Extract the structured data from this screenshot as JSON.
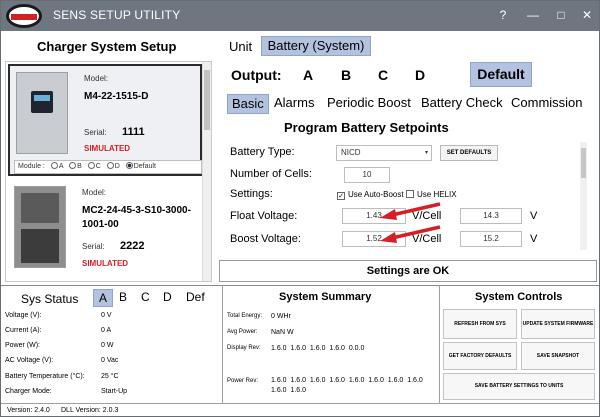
{
  "app": {
    "title": "SENS SETUP UTILITY"
  },
  "window_controls": {
    "help": "?",
    "minimize": "—",
    "maximize": "□",
    "close": "✕"
  },
  "left": {
    "title": "Charger System Setup",
    "chargers": [
      {
        "model_label": "Model:",
        "model": "M4-22-1515-D",
        "serial_label": "Serial:",
        "serial": "1111",
        "status": "SIMULATED",
        "selected": true
      },
      {
        "model_label": "Model:",
        "model": "MC2-24-45-3-S10-3000-1001-00",
        "serial_label": "Serial:",
        "serial": "2222",
        "status": "SIMULATED",
        "selected": false
      }
    ],
    "module_row": {
      "label": "Module",
      "separator": ":",
      "options": [
        "A",
        "B",
        "C",
        "D",
        "Default"
      ],
      "selected": "Default"
    }
  },
  "unit": {
    "label": "Unit",
    "value": "Battery (System)"
  },
  "output": {
    "label": "Output:",
    "options": [
      "A",
      "B",
      "C",
      "D"
    ],
    "default_label": "Default"
  },
  "tabs": [
    "Basic",
    "Alarms",
    "Periodic Boost",
    "Battery Check",
    "Commission"
  ],
  "program": {
    "title": "Program Battery Setpoints",
    "battery_type_label": "Battery Type:",
    "battery_type": "NICD",
    "set_defaults": "SET DEFAULTS",
    "cells_label": "Number of Cells:",
    "cells": "10",
    "settings_label": "Settings:",
    "auto_boost_label": "Use Auto-Boost",
    "auto_boost_checked": true,
    "helix_label": "Use HELIX",
    "helix_checked": false,
    "float_label": "Float Voltage:",
    "float_value": "1.43",
    "float_unit": "V/Cell",
    "float_total": "14.3",
    "float_total_unit": "V",
    "boost_label": "Boost Voltage:",
    "boost_value": "1.52",
    "boost_unit": "V/Cell",
    "boost_total": "15.2",
    "boost_total_unit": "V"
  },
  "status_message": "Settings are OK",
  "sys_status": {
    "title": "Sys Status",
    "options": [
      "A",
      "B",
      "C",
      "D",
      "Def"
    ],
    "selected": "A",
    "rows": [
      {
        "label": "Voltage (V):",
        "value": "0 V"
      },
      {
        "label": "Current (A):",
        "value": "0 A"
      },
      {
        "label": "Power (W):",
        "value": "0 W"
      },
      {
        "label": "AC Voltage (V):",
        "value": "0 Vac"
      },
      {
        "label": "Battery Temperature (°C):",
        "value": "25 °C"
      },
      {
        "label": "Charger Mode:",
        "value": "Start-Up"
      }
    ]
  },
  "summary": {
    "title": "System Summary",
    "total_energy_label": "Total Energy:",
    "total_energy": "0 WHr",
    "avg_power_label": "Avg Power:",
    "avg_power": "NaN W",
    "display_rev_label": "Display Rev:",
    "display_rev": "1.6.0  1.6.0  1.6.0  1.6.0  0.0.0",
    "power_rev_label": "Power Rev:",
    "power_rev": "1.6.0  1.6.0  1.6.0  1.6.0  1.6.0  1.6.0  1.6.0  1.6.0  1.6.0  1.6.0"
  },
  "controls": {
    "title": "System Controls",
    "refresh": "REFRESH FROM SYS",
    "update_firmware": "UPDATE SYSTEM FIRMWARE",
    "factory_defaults": "GET FACTORY DEFAULTS",
    "snapshot": "SAVE SNAPSHOT",
    "save_battery": "SAVE BATTERY SETTINGS TO UNITS"
  },
  "footer": {
    "version": "Version: 2.4.0",
    "dll_version": "DLL Version: 2.0.3"
  },
  "colors": {
    "titlebar": "#6e7680",
    "selected_button": "#b3c3df",
    "simulated": "#d41f26",
    "arrow": "#d41f26"
  }
}
